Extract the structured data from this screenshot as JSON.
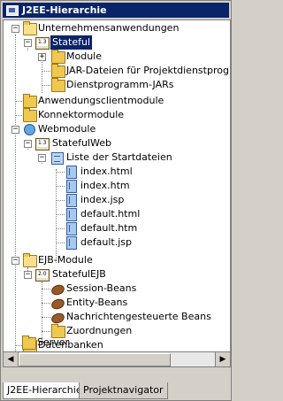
{
  "window": {
    "title": "J2EE-Hierarchie"
  },
  "tree": [
    {
      "label": "Unternehmensanwendungen",
      "icon": "folder-icon"
    },
    {
      "label": "Stateful",
      "icon": "ear-icon"
    },
    {
      "label": "Module",
      "icon": "folder-icon"
    },
    {
      "label": "JAR-Dateien für Projektdienstprogramme",
      "icon": "folder-icon"
    },
    {
      "label": "Dienstprogramm-JARs",
      "icon": "folder-icon"
    },
    {
      "label": "Anwendungsclientmodule",
      "icon": "folder-icon"
    },
    {
      "label": "Konnektormodule",
      "icon": "folder-icon"
    },
    {
      "label": "Webmodule",
      "icon": "globe-icon"
    },
    {
      "label": "StatefulWeb",
      "icon": "web-module-icon"
    },
    {
      "label": "Liste der Startdateien",
      "icon": "list-icon"
    },
    {
      "label": "index.html",
      "icon": "file-icon"
    },
    {
      "label": "index.htm",
      "icon": "file-icon"
    },
    {
      "label": "index.jsp",
      "icon": "file-icon"
    },
    {
      "label": "default.html",
      "icon": "file-icon"
    },
    {
      "label": "default.htm",
      "icon": "file-icon"
    },
    {
      "label": "default.jsp",
      "icon": "file-icon"
    },
    {
      "label": "EJB-Module",
      "icon": "ejb-icon"
    },
    {
      "label": "StatefulEJB",
      "icon": "ejb-module-icon"
    },
    {
      "label": "Session-Beans",
      "icon": "bean-icon"
    },
    {
      "label": "Entity-Beans",
      "icon": "bean-icon"
    },
    {
      "label": "Nachrichtengesteuerte Beans",
      "icon": "bean-icon"
    },
    {
      "label": "Zuordnungen",
      "icon": "folder-icon"
    },
    {
      "label": "Datenbanken",
      "icon": "folder-icon"
    },
    {
      "label": "Server",
      "icon": "folder-icon"
    }
  ],
  "tabs": [
    {
      "label": "J2EE-Hierarchie"
    },
    {
      "label": "Projektnavigator"
    }
  ],
  "scrollbar": {
    "left_arrow": "◀",
    "right_arrow": "▶"
  }
}
